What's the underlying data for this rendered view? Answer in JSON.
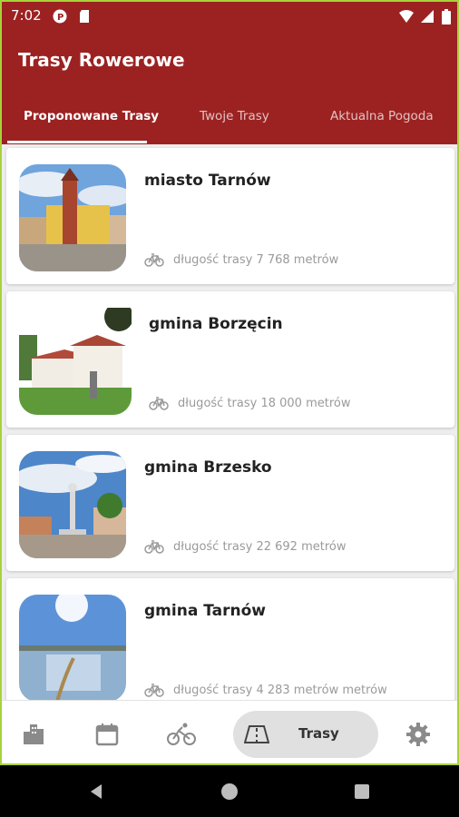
{
  "status_bar": {
    "time": "7:02"
  },
  "app_bar": {
    "title": "Trasy Rowerowe"
  },
  "tabs": [
    {
      "label": "Proponowane Trasy",
      "active": true
    },
    {
      "label": "Twoje Trasy",
      "active": false
    },
    {
      "label": "Aktualna Pogoda",
      "active": false
    }
  ],
  "routes": [
    {
      "name": "miasto Tarnów",
      "length": "długość trasy 7 768 metrów",
      "icon": "bike-icon"
    },
    {
      "name": "gmina Borzęcin",
      "length": "długość trasy 18 000 metrów",
      "icon": "bike-icon"
    },
    {
      "name": "gmina Brzesko",
      "length": "długość trasy 22 692 metrów",
      "icon": "bike-icon"
    },
    {
      "name": "gmina Tarnów",
      "length": "długość trasy 4 283 metrów metrów",
      "icon": "bike-icon"
    }
  ],
  "bottom_nav": {
    "items": [
      "city-icon",
      "calendar-icon",
      "cyclist-icon",
      "map-icon",
      "settings-icon"
    ],
    "active_label": "Trasy"
  },
  "colors": {
    "primary": "#9c2222",
    "device_border": "#a8d23a",
    "pill": "#e0e0e0"
  }
}
